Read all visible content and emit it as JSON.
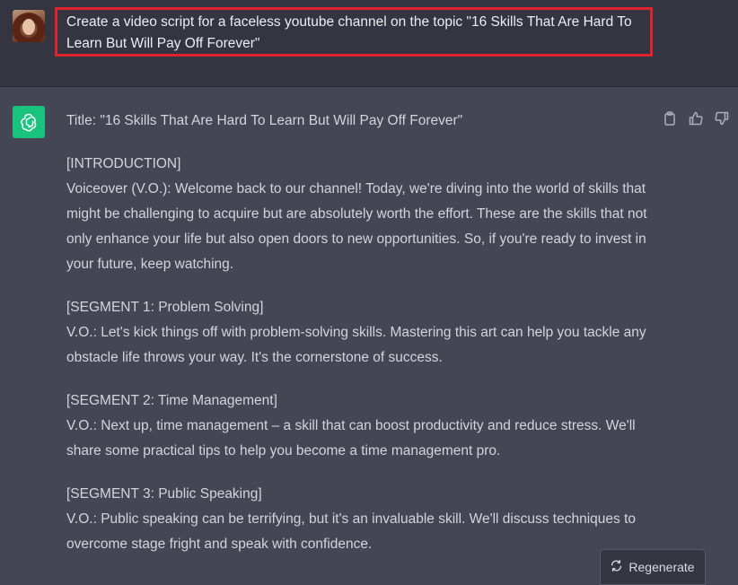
{
  "user_message": {
    "text": "Create a video script for a faceless youtube channel on the topic \"16 Skills That Are Hard To Learn But Will Pay Off Forever\""
  },
  "response": {
    "title": "Title: \"16 Skills That Are Hard To Learn But Will Pay Off Forever\"",
    "sections": [
      {
        "heading": "[INTRODUCTION]",
        "body": "Voiceover (V.O.): Welcome back to our channel! Today, we're diving into the world of skills that might be challenging to acquire but are absolutely worth the effort. These are the skills that not only enhance your life but also open doors to new opportunities. So, if you're ready to invest in your future, keep watching."
      },
      {
        "heading": "[SEGMENT 1: Problem Solving]",
        "body": "V.O.: Let's kick things off with problem-solving skills. Mastering this art can help you tackle any obstacle life throws your way. It's the cornerstone of success."
      },
      {
        "heading": "[SEGMENT 2: Time Management]",
        "body": "V.O.: Next up, time management – a skill that can boost productivity and reduce stress. We'll share some practical tips to help you become a time management pro."
      },
      {
        "heading": "[SEGMENT 3: Public Speaking]",
        "body": "V.O.: Public speaking can be terrifying, but it's an invaluable skill. We'll discuss techniques to overcome stage fright and speak with confidence."
      }
    ]
  },
  "buttons": {
    "regenerate": "Regenerate"
  },
  "colors": {
    "accent": "#19c37d",
    "highlight_border": "#e0212e"
  },
  "icons": [
    "avatar",
    "openai-logo-icon",
    "copy-icon",
    "thumbs-up-icon",
    "thumbs-down-icon",
    "refresh-icon"
  ]
}
